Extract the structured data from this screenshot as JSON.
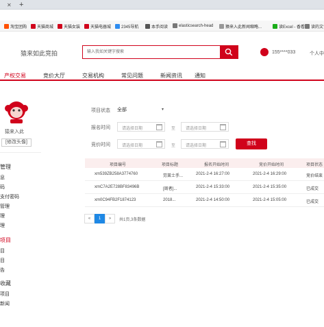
{
  "browser": {
    "bookmarks": [
      {
        "label": "淘宝团购",
        "color": "#ff5000"
      },
      {
        "label": "天猫商城",
        "color": "#d0021b"
      },
      {
        "label": "天猫女装",
        "color": "#d0021b"
      },
      {
        "label": "天猫电器城",
        "color": "#d0021b"
      },
      {
        "label": "2345导航",
        "color": "#2d8cf0"
      },
      {
        "label": "本手阅读",
        "color": "#555555"
      },
      {
        "label": "elasticsearch-head",
        "color": "#777777"
      },
      {
        "label": "猿来入此新闻缩略...",
        "color": "#999999"
      },
      {
        "label": "读Excel - 香看",
        "color": "#1aad19"
      },
      {
        "label": "读的文包",
        "color": "#777777"
      }
    ]
  },
  "header": {
    "logo_text": "猿来如此竞拍",
    "search_placeholder": "输入我如关键字搜索",
    "user_phone": "155****033",
    "user_center": "个人中心"
  },
  "nav": [
    "产权交易",
    "竞价大厅",
    "交易机构",
    "常见问题",
    "新闻资讯",
    "通知"
  ],
  "sidebar": {
    "name": "猿来入此",
    "edit_avatar": "[修改头像]",
    "items": [
      {
        "label": "管理",
        "kind": "section"
      },
      {
        "label": "息",
        "kind": "item"
      },
      {
        "label": "码",
        "kind": "item"
      },
      {
        "label": "支付密码",
        "kind": "item"
      },
      {
        "label": "管理",
        "kind": "item"
      },
      {
        "label": "理",
        "kind": "item"
      },
      {
        "label": "理",
        "kind": "item"
      },
      {
        "label": "项目",
        "kind": "section-red"
      },
      {
        "label": "目",
        "kind": "item"
      },
      {
        "label": "目",
        "kind": "item"
      },
      {
        "label": "告",
        "kind": "item"
      },
      {
        "label": "收藏",
        "kind": "section"
      },
      {
        "label": "项目",
        "kind": "item"
      },
      {
        "label": "新闻",
        "kind": "item"
      }
    ]
  },
  "filters": {
    "status_label": "项目状态",
    "status_value": "全部",
    "signup_label": "报名时间",
    "bid_label": "竞价时间",
    "date_placeholder": "请选择日期",
    "to_label": "至",
    "find_button": "查找"
  },
  "table": {
    "headers": [
      "项目编号",
      "项目标题",
      "报名开始时间",
      "竞价开始时间",
      "项目状态"
    ],
    "rows": [
      [
        "xm539ZB258A3774760",
        "劳莱士手...",
        "2021-2-4 16:27:00",
        "2021-2-4 16:29:00",
        "竞价结束"
      ],
      [
        "xmC7A2E728BF83496B",
        "[周者]...",
        "2021-2-4 15:33:00",
        "2021-2-4 15:35:00",
        "已成交"
      ],
      [
        "xm0C94FB2F1874123",
        "2018...",
        "2021-2-4 14:50:00",
        "2021-2-4 15:05:00",
        "已成交"
      ]
    ]
  },
  "pagination": {
    "prev": "«",
    "current": "1",
    "next": "»",
    "info": "共1页,3条数据"
  },
  "colors": {
    "accent": "#d0021b",
    "page_active": "#1e88e5"
  }
}
